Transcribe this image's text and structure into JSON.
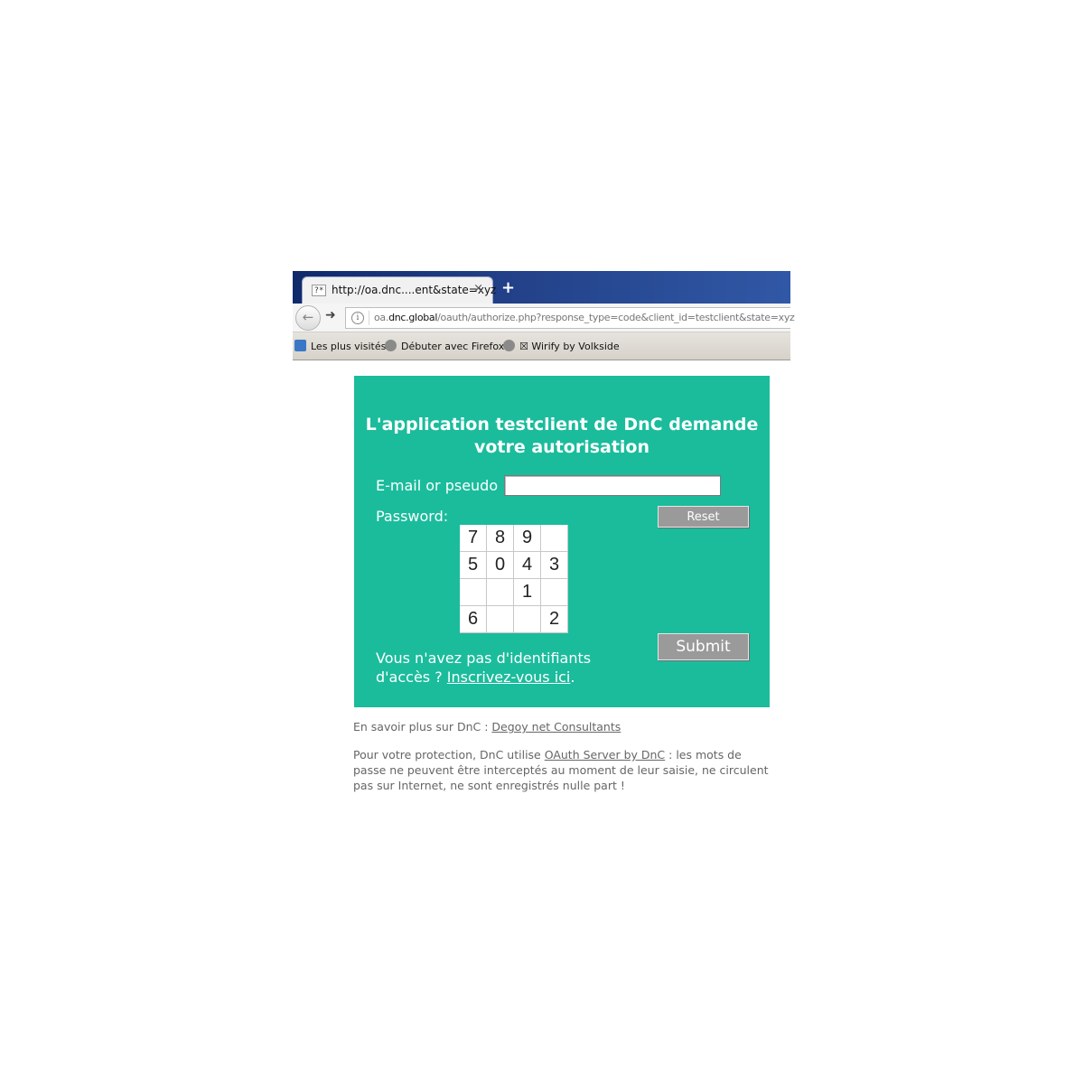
{
  "browser": {
    "tab_title": "http://oa.dnc....ent&state=xyz",
    "tab_close": "×",
    "new_tab": "+",
    "url_prefix": "oa.",
    "url_domain": "dnc.global",
    "url_path": "/oauth/authorize.php?response_type=code&client_id=testclient&state=xyz",
    "bookmarks": [
      "Les plus visités",
      "Débuter avec Firefox",
      "☒ Wirify by Volkside"
    ]
  },
  "form": {
    "heading_line1": "L'application testclient de DnC demande",
    "heading_line2": "votre autorisation",
    "email_label": "E-mail or pseudo :",
    "email_value": "",
    "password_label": "Password:",
    "reset_label": "Reset",
    "submit_label": "Submit",
    "keypad": [
      "7",
      "8",
      "9",
      "",
      "5",
      "0",
      "4",
      "3",
      "",
      "",
      "1",
      "",
      "6",
      "",
      "",
      "2"
    ],
    "signup_text": "Vous n'avez pas d'identifiants d'accès ? ",
    "signup_link": "Inscrivez-vous ici",
    "signup_end": "."
  },
  "footer": {
    "learn_more_text": "En savoir plus sur DnC : ",
    "learn_more_link": "Degoy net Consultants",
    "protection_text_1": "Pour votre protection, DnC utilise ",
    "protection_link": "OAuth Server by DnC",
    "protection_text_2": " : les mots de passe ne peuvent être interceptés au moment de leur saisie, ne circulent pas sur Internet, ne sont enregistrés nulle part !"
  }
}
